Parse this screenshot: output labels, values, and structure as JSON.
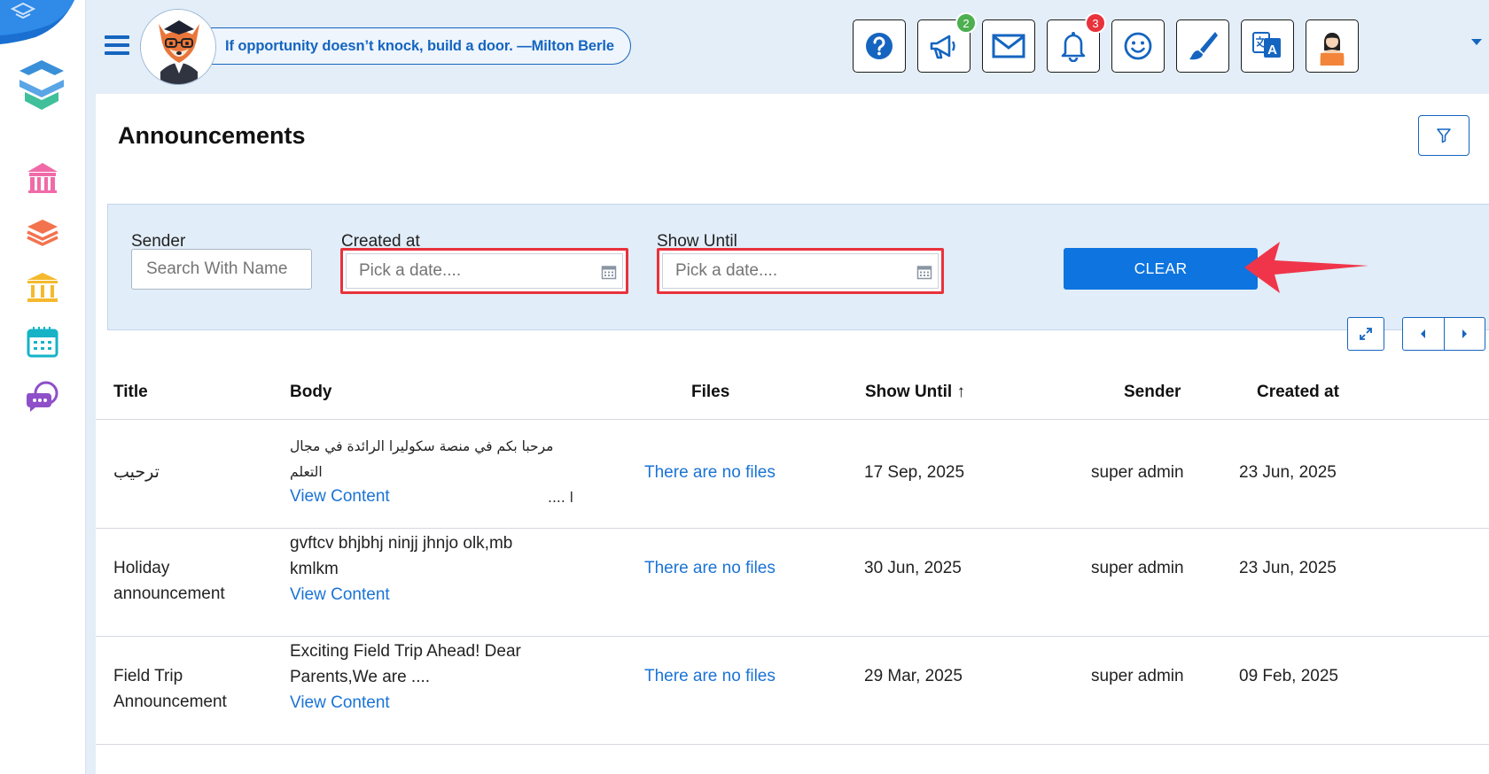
{
  "header": {
    "quote": "If opportunity doesn’t knock, build a door. —Milton Berle",
    "badges": {
      "announcements": "2",
      "notifications": "3"
    },
    "accent": "#1565c0"
  },
  "page": {
    "title": "Announcements"
  },
  "filters": {
    "sender_label": "Sender",
    "sender_placeholder": "Search With Name",
    "created_label": "Created at",
    "created_placeholder": "Pick a date....",
    "show_until_label": "Show Until",
    "show_until_placeholder": "Pick a date....",
    "clear_label": "CLEAR"
  },
  "table": {
    "columns": [
      "Title",
      "Body",
      "Files",
      "Show Until",
      "Sender",
      "Created at"
    ],
    "sort_indicator": "↑",
    "rows": [
      {
        "title_lines": [
          "ترحيب"
        ],
        "body_lines": [
          "مرحبا بكم في منصة سكوليرا الرائدة في مجال التعلم",
          "ا ...."
        ],
        "view_label": "View Content",
        "files": "There are no files",
        "show_until": "17 Sep, 2025",
        "sender": "super admin",
        "created_at": "23 Jun, 2025"
      },
      {
        "title_lines": [
          "Holiday",
          "announcement"
        ],
        "body_lines": [
          "gvftcv bhjbhj ninjj jhnjo olk,mb",
          "kmlkm"
        ],
        "view_label": "View Content",
        "files": "There are no files",
        "show_until": "30 Jun, 2025",
        "sender": "super admin",
        "created_at": "23 Jun, 2025"
      },
      {
        "title_lines": [
          "Field Trip",
          "Announcement"
        ],
        "body_lines": [
          "Exciting Field Trip Ahead! Dear",
          "Parents,We are ...."
        ],
        "view_label": "View Content",
        "files": "There are no files",
        "show_until": "29 Mar, 2025",
        "sender": "super admin",
        "created_at": "09 Feb, 2025"
      }
    ]
  }
}
